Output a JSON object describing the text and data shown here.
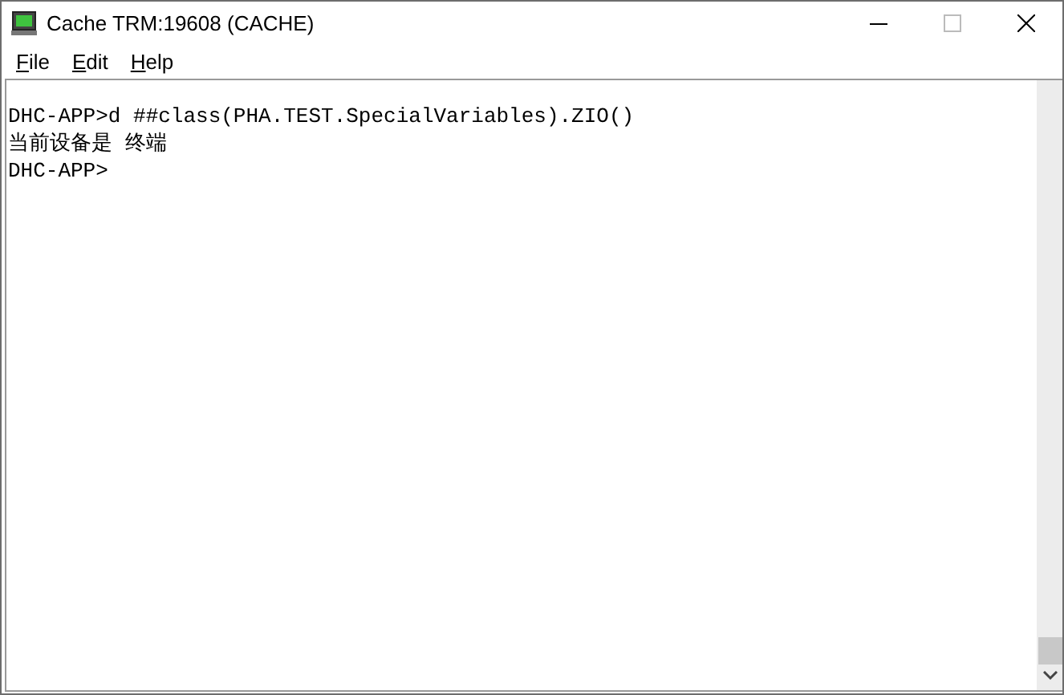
{
  "window": {
    "title": "Cache TRM:19608 (CACHE)"
  },
  "menu": [
    "File",
    "Edit",
    "Help"
  ],
  "terminal": {
    "lines": [
      "DHC-APP>d ##class(PHA.TEST.SpecialVariables).ZIO()",
      "当前设备是 终端",
      "DHC-APP>"
    ]
  }
}
